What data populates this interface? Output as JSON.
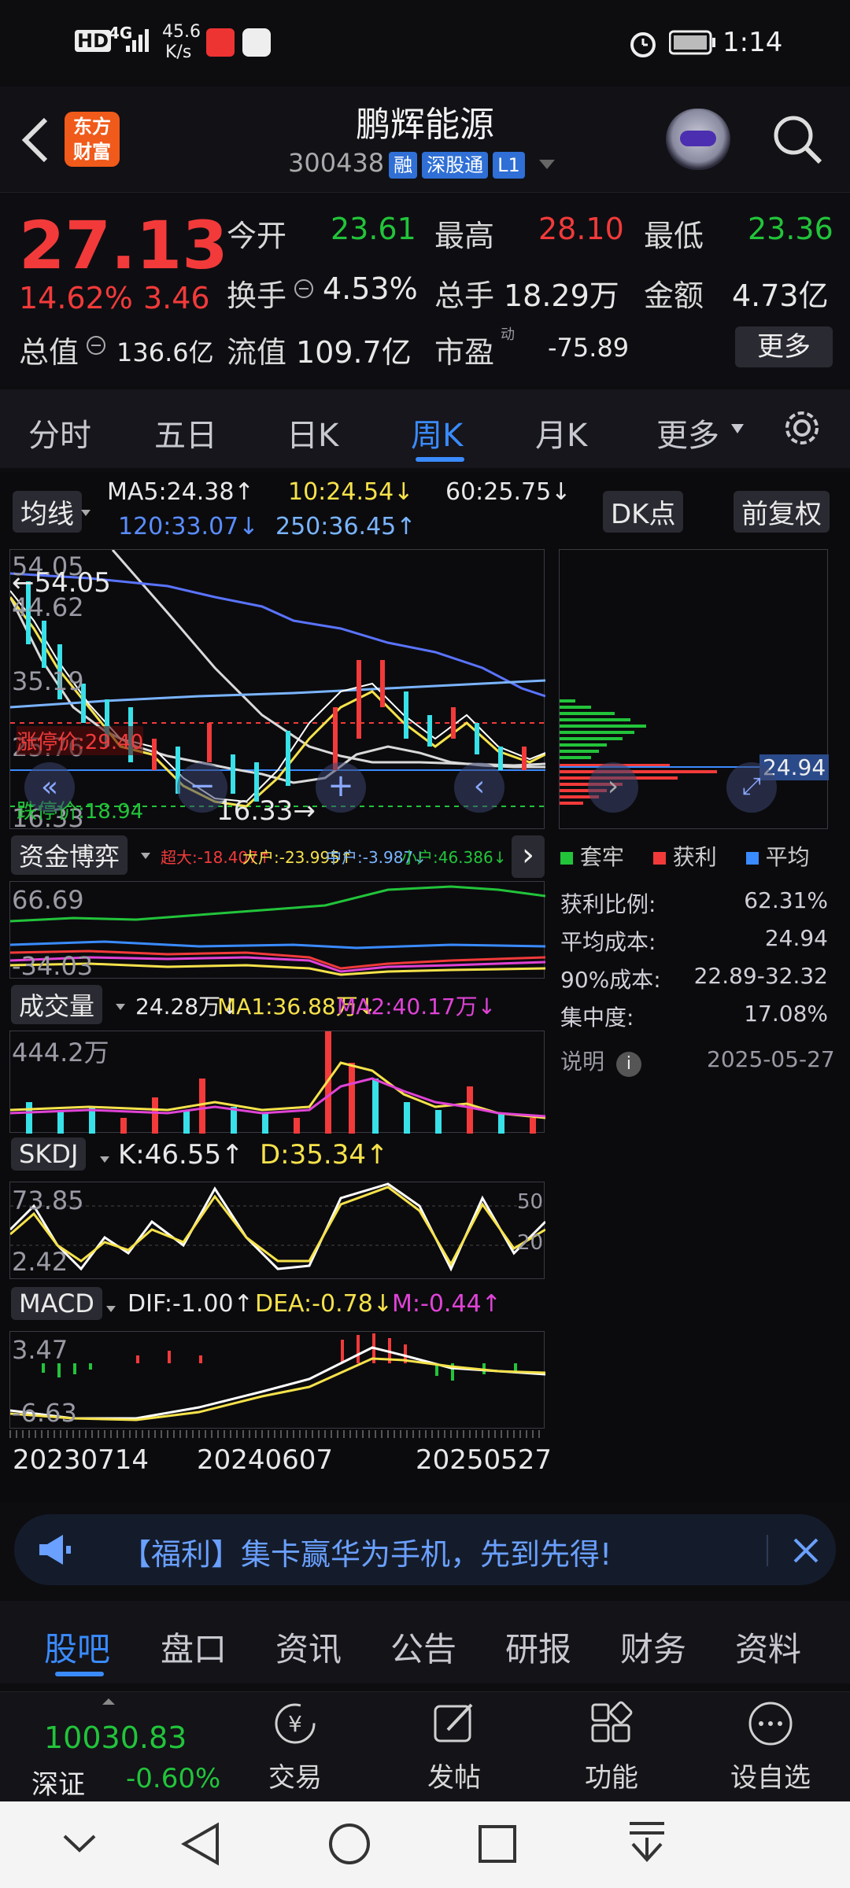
{
  "status_bar": {
    "hd": "HD",
    "signal": "4G",
    "speed_value": "45.6",
    "speed_unit": "K/s",
    "time": "1:14"
  },
  "header": {
    "logo_line1": "东方",
    "logo_line2": "财富",
    "stock_name": "鹏辉能源",
    "stock_code": "300438",
    "badges": [
      "融",
      "深股通",
      "L1"
    ]
  },
  "quote": {
    "price": "27.13",
    "change_pct": "14.62%",
    "change_abs": "3.46",
    "open_label": "今开",
    "open": "23.61",
    "high_label": "最高",
    "high": "28.10",
    "low_label": "最低",
    "low": "23.36",
    "turnover_label": "换手",
    "turnover": "4.53%",
    "volume_label": "总手",
    "volume": "18.29万",
    "amount_label": "金额",
    "amount": "4.73亿",
    "mktcap_label": "总值",
    "mktcap": "136.6亿",
    "float_label": "流值",
    "float": "109.7亿",
    "pe_label": "市盈",
    "pe_sup": "动",
    "pe": "-75.89",
    "more_button": "更多"
  },
  "tabs": [
    "分时",
    "五日",
    "日K",
    "周K",
    "月K",
    "更多"
  ],
  "active_tab": "周K",
  "chart": {
    "ma_chip": "均线",
    "ma5": "MA5:24.38↑",
    "ma10": "10:24.54↓",
    "ma60": "60:25.75↓",
    "ma120": "120:33.07↓",
    "ma250": "250:36.45↑",
    "dk_chip": "DK点",
    "fq_chip": "前复权",
    "price_labels": [
      "54.05",
      "44.62",
      "35.19",
      "25.76",
      "16.33"
    ],
    "high_marker": "←54.05",
    "low_marker": "16.33→",
    "limit_up": "涨停价:29.40",
    "limit_down": "跌停价:18.94",
    "cost_marker": "24.94",
    "fund_chip": "资金博弈",
    "fund_legend": [
      "超大:-18.407↑",
      "大户:-23.995↑",
      "中户:-3.987↓",
      "小户:46.386↓"
    ],
    "fund_axis": [
      "66.69",
      "-34.03"
    ],
    "vol_chip": "成交量",
    "vol_value": "24.28万↓",
    "vol_ma1": "MA1:36.88万↓",
    "vol_ma2": "MA2:40.17万↓",
    "vol_axis": "444.2万",
    "skdj_chip": "SKDJ",
    "skdj_k": "K:46.55↑",
    "skdj_d": "D:35.34↑",
    "skdj_axis": [
      "73.85",
      "2.42",
      "50",
      "20"
    ],
    "macd_chip": "MACD",
    "macd_dif": "DIF:-1.00↑",
    "macd_dea": "DEA:-0.78↓",
    "macd_m": "M:-0.44↑",
    "macd_axis": [
      "3.47",
      "-6.63"
    ],
    "dates": [
      "20230714",
      "20240607",
      "20250527"
    ]
  },
  "chip_stats": {
    "legend": [
      "套牢",
      "获利",
      "平均"
    ],
    "rows": [
      {
        "label": "获利比例:",
        "value": "62.31%"
      },
      {
        "label": "平均成本:",
        "value": "24.94"
      },
      {
        "label": "90%成本:",
        "value": "22.89-32.32"
      },
      {
        "label": "集中度:",
        "value": "17.08%"
      }
    ],
    "note_label": "说明",
    "date": "2025-05-27"
  },
  "banner": {
    "text": "【福利】集卡赢华为手机，先到先得!"
  },
  "bottom_tabs": [
    "股吧",
    "盘口",
    "资讯",
    "公告",
    "研报",
    "财务",
    "资料"
  ],
  "active_bottom_tab": "股吧",
  "bottom_bar": {
    "index_value": "10030.83",
    "index_name": "深证",
    "index_change": "-0.60%",
    "items": [
      "交易",
      "发帖",
      "功能",
      "设自选"
    ]
  },
  "colors": {
    "up": "#f23a3a",
    "down": "#22c43a",
    "accent": "#3a8bff"
  }
}
